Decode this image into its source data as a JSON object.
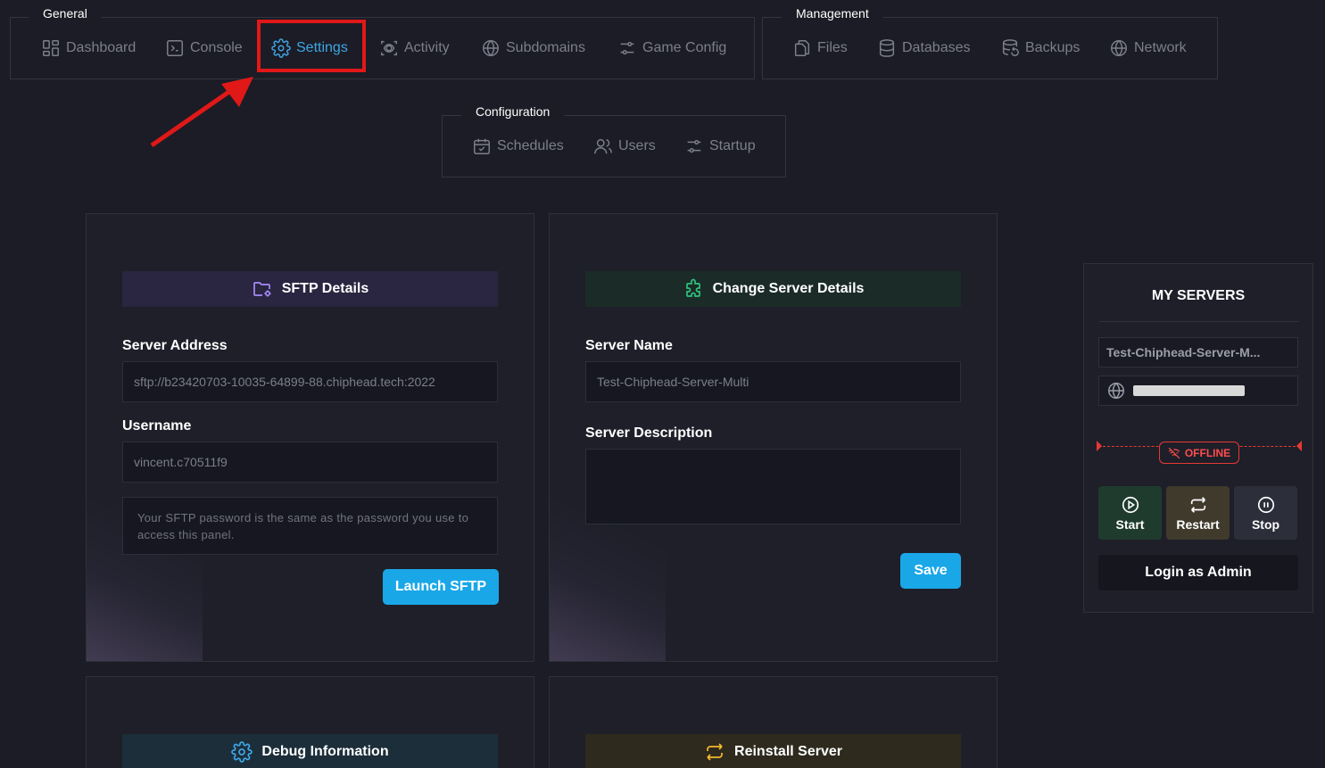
{
  "nav": {
    "general": {
      "label": "General",
      "items": [
        {
          "label": "Dashboard",
          "icon": "dashboard-icon"
        },
        {
          "label": "Console",
          "icon": "console-icon"
        },
        {
          "label": "Settings",
          "icon": "gear-icon",
          "active": true
        },
        {
          "label": "Activity",
          "icon": "activity-icon"
        },
        {
          "label": "Subdomains",
          "icon": "globe-icon"
        },
        {
          "label": "Game Config",
          "icon": "sliders-icon"
        }
      ]
    },
    "management": {
      "label": "Management",
      "items": [
        {
          "label": "Files",
          "icon": "files-icon"
        },
        {
          "label": "Databases",
          "icon": "database-icon"
        },
        {
          "label": "Backups",
          "icon": "backup-icon"
        },
        {
          "label": "Network",
          "icon": "globe-icon"
        }
      ]
    },
    "configuration": {
      "label": "Configuration",
      "items": [
        {
          "label": "Schedules",
          "icon": "calendar-icon"
        },
        {
          "label": "Users",
          "icon": "users-icon"
        },
        {
          "label": "Startup",
          "icon": "sliders-icon"
        }
      ]
    }
  },
  "sftp": {
    "title": "SFTP Details",
    "address_label": "Server Address",
    "address_value": "sftp://b23420703-10035-64899-88.chiphead.tech:2022",
    "username_label": "Username",
    "username_value": "vincent.c70511f9",
    "note": "Your SFTP password is the same as the password you use to access this panel.",
    "button": "Launch SFTP"
  },
  "server_details": {
    "title": "Change Server Details",
    "name_label": "Server Name",
    "name_value": "Test-Chiphead-Server-Multi",
    "description_label": "Server Description",
    "description_value": "",
    "button": "Save"
  },
  "debug": {
    "title": "Debug Information"
  },
  "reinstall": {
    "title": "Reinstall Server"
  },
  "sidebar": {
    "title": "MY SERVERS",
    "server_name": "Test-Chiphead-Server-M...",
    "status": "OFFLINE",
    "start": "Start",
    "restart": "Restart",
    "stop": "Stop",
    "login_admin": "Login as Admin"
  },
  "colors": {
    "accent": "#1aa7e8",
    "active_nav": "#3ea6e6",
    "offline": "#e53935",
    "highlight": "#e01818"
  }
}
